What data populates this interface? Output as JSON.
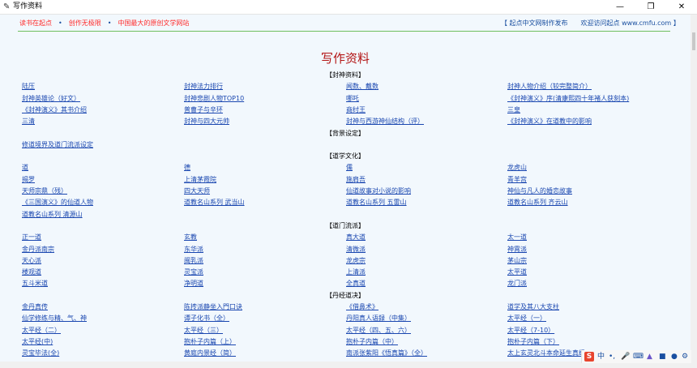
{
  "window": {
    "title": "写作资料"
  },
  "topbar": {
    "left": [
      "读书在起点",
      "创作无极限",
      "中国最大的原创文学网站"
    ],
    "left_sep": "•",
    "right": "【 起点中文网制作发布　　欢迎访问起点 www.cmfu.com 】"
  },
  "page_title": "写作资料",
  "sections": [
    {
      "title": "【封神资料】",
      "rows": [
        [
          "陆压",
          "封神法力排行",
          "闻数、戴数",
          "封神人物介绍（较完整简介）"
        ],
        [
          "封神英雄论（好文）",
          "封神悲剧人物TOP10",
          "哪吒",
          "《封神演义》序(清康熙四十年褚人获刻本)"
        ],
        [
          "《封神演义》其书介绍",
          "普曹子与辛环",
          "商纣王",
          "三皇"
        ],
        [
          "三清",
          "封神与四大元帅",
          "封神与西游神仙结构（评）",
          "《封神演义》在道教中的影响"
        ]
      ]
    },
    {
      "title": "【背景设定】",
      "rows": [
        [
          "修道境界及道门流派设定"
        ]
      ]
    },
    {
      "title": "【道学文化】",
      "rows": [
        [
          "道",
          "德",
          "儒",
          "龙虎山"
        ],
        [
          "揭罗",
          "上清茅霞院",
          "施肩吾",
          "青羊宫"
        ],
        [
          "天师宗鼎（残）",
          "四大天师",
          "仙道故事对小说的影响",
          "神仙与凡人的婚恋故事"
        ],
        [
          "《三国演义》的仙道人物",
          "道教名山系列 武当山",
          "道教名山系列 五雷山",
          "道教名山系列 齐云山"
        ],
        [
          "道教名山系列 清源山"
        ]
      ]
    },
    {
      "title": "【道门流派】",
      "rows": [
        [
          "正一道",
          "玄教",
          "真大道",
          "太一道"
        ],
        [
          "金丹派南宗",
          "东华派",
          "清微派",
          "神霄派"
        ],
        [
          "天心派",
          "闽乳派",
          "龙虎宗",
          "茅山宗"
        ],
        [
          "楼观道",
          "灵宝派",
          "上清派",
          "太平道"
        ],
        [
          "五斗米道",
          "净明道",
          "全真道",
          "龙门派"
        ]
      ]
    },
    {
      "title": "【丹经道决】",
      "rows": [
        [
          "金丹真传",
          "陈抟派静坐入門口诀",
          "《借鼻术》",
          "道学及其八大支柱"
        ],
        [
          "仙学修练与精、气、神",
          "谭子化书（全）",
          "丹阳真人语録（中集）",
          "太平经（一）"
        ],
        [
          "太平经（二）",
          "太平经（三）",
          "太平经（四、五、六）",
          "太平经（7-10）"
        ],
        [
          "太平经(中)",
          "抱朴子内篇（上）",
          "抱朴子内篇（中）",
          "抱朴子内篇（下）"
        ],
        [
          "灵宝毕法(全)",
          "黄庭内景经（简）",
          "南派张紫阳《悟真篇》（全）",
          "太上玄灵北斗本命延生真经"
        ]
      ]
    }
  ],
  "tray": {
    "icons": [
      "sogou-logo-icon",
      "chinese-mode-icon",
      "punctuation-icon",
      "mic-icon",
      "keyboard-icon",
      "skin-icon",
      "tools-icon",
      "user-icon",
      "settings-icon"
    ],
    "ime_label": "中"
  }
}
